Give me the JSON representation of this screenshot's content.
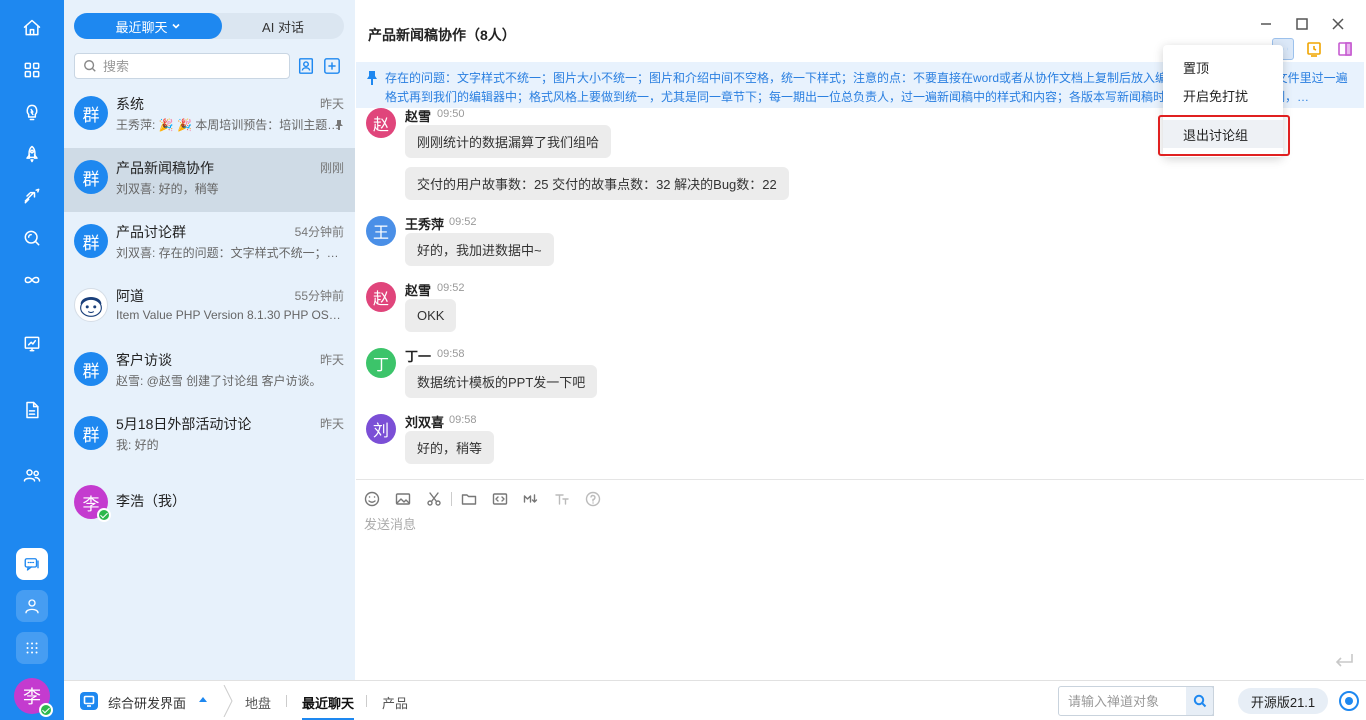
{
  "rail": {
    "icons": [
      "home-icon",
      "apps-icon",
      "lightbulb-icon",
      "rocket-icon",
      "sprint-icon",
      "search-icon",
      "infinity-icon",
      "board-icon",
      "document-icon",
      "team-icon"
    ],
    "bottom_icons": [
      "chat-icon",
      "contacts-icon",
      "grid-icon"
    ],
    "avatar_text": "李"
  },
  "list": {
    "tab_recent": "最近聊天",
    "tab_ai": "AI 对话",
    "search_placeholder": "搜索",
    "conversations": [
      {
        "avatar": "群",
        "name": "系统",
        "time": "昨天",
        "preview": "王秀萍: 🎉 🎉 本周培训预告：培训主题…",
        "pinned": true
      },
      {
        "avatar": "群",
        "name": "产品新闻稿协作",
        "time": "刚刚",
        "preview": "刘双喜: 好的，稍等",
        "active": true
      },
      {
        "avatar": "群",
        "name": "产品讨论群",
        "time": "54分钟前",
        "preview": "刘双喜: 存在的问题：文字样式不统一；图片…"
      },
      {
        "avatar": "",
        "name": "阿道",
        "time": "55分钟前",
        "preview": "Item Value PHP Version 8.1.30 PHP OS Li…"
      },
      {
        "avatar": "群",
        "name": "客户访谈",
        "time": "昨天",
        "preview": "赵雪: @赵雪 创建了讨论组 客户访谈。"
      },
      {
        "avatar": "群",
        "name": "5月18日外部活动讨论",
        "time": "昨天",
        "preview": "我: 好的"
      },
      {
        "avatar": "李",
        "name": "李浩（我）",
        "time": "",
        "preview": ""
      }
    ]
  },
  "chat": {
    "title": "产品新闻稿协作（8人）",
    "notice": "存在的问题：文字样式不统一；图片大小不统一；图片和介绍中间不空格，统一下样式；注意的点：不要直接在word或者从协作文档上复制后放入编辑器，要先复制到txt文件里过一遍格式再到我们的编辑器中；格式风格上要做到统一，尤其是同一章节下；每一期出一位总负责人，过一遍新闻稿中的样式和内容；各版本写新闻稿时注意不要将新闻稿复制，…",
    "messages": [
      {
        "avatar": "赵",
        "color": "#e0457b",
        "sender": "赵雪",
        "time": "09:50",
        "bubbles": [
          "刚刚统计的数据漏算了我们组哈",
          "交付的用户故事数：25  交付的故事点数：32  解决的Bug数：22"
        ]
      },
      {
        "avatar": "王",
        "color": "#4a8fe7",
        "sender": "王秀萍",
        "time": "09:52",
        "bubbles": [
          "好的，我加进数据中~"
        ]
      },
      {
        "avatar": "赵",
        "color": "#e0457b",
        "sender": "赵雪",
        "time": "09:52",
        "bubbles": [
          "OKK"
        ]
      },
      {
        "avatar": "丁",
        "color": "#3cc46a",
        "sender": "丁一",
        "time": "09:58",
        "bubbles": [
          "数据统计模板的PPT发一下吧"
        ]
      },
      {
        "avatar": "刘",
        "color": "#7b4fd6",
        "sender": "刘双喜",
        "time": "09:58",
        "bubbles": [
          "好的，稍等"
        ]
      }
    ],
    "composer_placeholder": "发送消息"
  },
  "menu": {
    "items": [
      "置顶",
      "开启免打扰",
      "退出讨论组"
    ]
  },
  "bottom": {
    "workspace": "综合研发界面",
    "tabs": [
      "地盘",
      "最近聊天",
      "产品"
    ],
    "active_tab": "最近聊天",
    "object_search_placeholder": "请输入禅道对象",
    "version": "开源版21.1"
  },
  "colors": {
    "accent": "#1e88f0",
    "highlight_border": "#e02020"
  }
}
